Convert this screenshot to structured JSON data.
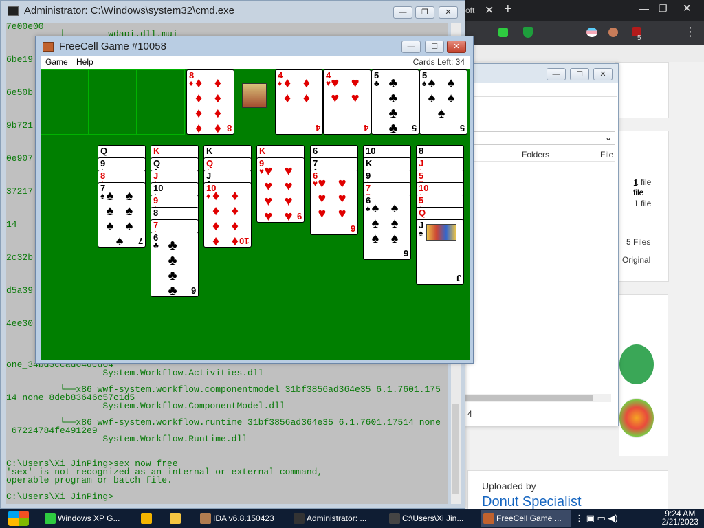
{
  "cmd": {
    "title": "Administrator: C:\\Windows\\system32\\cmd.exe",
    "lines": [
      "7e00e00",
      "          │        wdapi.dll.mui",
      "6be19",
      "6e50b",
      "9b721",
      "0e907",
      "37217",
      "14",
      "2c32b",
      "d5a39",
      "4ee30",
      "one_34bd3ccad64dcd64",
      "                  System.Workflow.Activities.dll",
      "          └──x86_wwf-system.workflow.componentmodel_31bf3856ad364e35_6.1.7601.175",
      "14_none_8deb83646c57c1d5",
      "                  System.Workflow.ComponentModel.dll",
      "          └──x86_wwf-system.workflow.runtime_31bf3856ad364e35_6.1.7601.17514_none",
      "_67224784fe4912e9",
      "                  System.Workflow.Runtime.dll",
      "C:\\Users\\Xi JinPing>sex now free",
      "'sex' is not recognized as an internal or external command,",
      "operable program or batch file.",
      "C:\\Users\\Xi JinPing>"
    ]
  },
  "freecell": {
    "title": "FreeCell Game #10058",
    "menu": [
      "Game",
      "Help"
    ],
    "cards_left": "Cards Left: 34",
    "free_cells": [
      {
        "rank": "",
        "suit": ""
      },
      {
        "rank": "",
        "suit": ""
      },
      {
        "rank": "",
        "suit": ""
      },
      {
        "rank": "8",
        "suit": "♦"
      }
    ],
    "foundations": [
      {
        "rank": "4",
        "suit": "♦"
      },
      {
        "rank": "4",
        "suit": "♥"
      },
      {
        "rank": "5",
        "suit": "♣"
      },
      {
        "rank": "5",
        "suit": "♠"
      }
    ],
    "columns": [
      [
        {
          "rank": "Q",
          "suit": "♠"
        },
        {
          "rank": "9",
          "suit": "♠"
        },
        {
          "rank": "8",
          "suit": "♦"
        },
        {
          "rank": "7",
          "suit": "♠"
        }
      ],
      [
        {
          "rank": "K",
          "suit": "♦"
        },
        {
          "rank": "Q",
          "suit": "♣"
        },
        {
          "rank": "J",
          "suit": "♦"
        },
        {
          "rank": "10",
          "suit": "♠"
        },
        {
          "rank": "9",
          "suit": "♦"
        },
        {
          "rank": "8",
          "suit": "♠"
        },
        {
          "rank": "7",
          "suit": "♦"
        },
        {
          "rank": "6",
          "suit": "♣"
        }
      ],
      [
        {
          "rank": "K",
          "suit": "♠"
        },
        {
          "rank": "Q",
          "suit": "♦"
        },
        {
          "rank": "J",
          "suit": "♣"
        },
        {
          "rank": "10",
          "suit": "♦"
        }
      ],
      [
        {
          "rank": "K",
          "suit": "♥"
        },
        {
          "rank": "9",
          "suit": "♥"
        }
      ],
      [
        {
          "rank": "6",
          "suit": "♠"
        },
        {
          "rank": "7",
          "suit": "♣"
        },
        {
          "rank": "6",
          "suit": "♥"
        }
      ],
      [
        {
          "rank": "10",
          "suit": "♠"
        },
        {
          "rank": "K",
          "suit": "♠"
        },
        {
          "rank": "9",
          "suit": "♠"
        },
        {
          "rank": "7",
          "suit": "♥"
        },
        {
          "rank": "6",
          "suit": "♠"
        }
      ],
      [
        {
          "rank": "8",
          "suit": "♠"
        },
        {
          "rank": "J",
          "suit": "♦"
        },
        {
          "rank": "5",
          "suit": "♥"
        },
        {
          "rank": "10",
          "suit": "♦"
        },
        {
          "rank": "5",
          "suit": "♦"
        },
        {
          "rank": "Q",
          "suit": "♦"
        },
        {
          "rank": "J",
          "suit": "♠"
        }
      ]
    ]
  },
  "explorer": {
    "folders_label": "Folders",
    "file_label": "File",
    "rows": [
      "1 file",
      "1 file",
      "5 Files",
      "Original"
    ],
    "bottom_value": "4"
  },
  "browser": {
    "tab_text": "oft",
    "uploaded_by": "Uploaded by",
    "uploader": "Donut Specialist",
    "badge": "5"
  },
  "taskbar": {
    "items": [
      {
        "label": "Windows XP G...",
        "color": "#2ecc40"
      },
      {
        "label": "",
        "color": "#f4b400"
      },
      {
        "label": "",
        "color": "#f5c542"
      },
      {
        "label": "IDA v6.8.150423",
        "color": "#b07c50"
      },
      {
        "label": "Administrator: ...",
        "color": "#333"
      },
      {
        "label": "C:\\Users\\Xi Jin...",
        "color": "#444"
      },
      {
        "label": "FreeCell Game ...",
        "color": "#c0622e"
      }
    ],
    "time": "9:24 AM",
    "date": "2/21/2023"
  }
}
